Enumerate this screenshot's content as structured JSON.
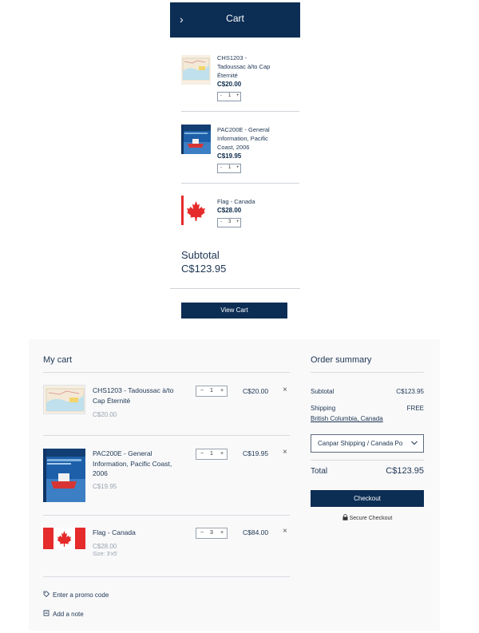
{
  "mini_cart": {
    "title": "Cart",
    "close_icon": "chevron-right-icon",
    "items": [
      {
        "name": "CHS1203 - Tadoussac à/to Cap Éternité",
        "name_lines": [
          "CHS1203 -",
          "Tadoussac à/to Cap",
          "Éternité"
        ],
        "price": "C$20.00",
        "quantity": "1",
        "thumbnail": "nautical-chart-image"
      },
      {
        "name": "PAC200E - General Information, Pacific Coast, 2006",
        "name_lines": [
          "PAC200E - General",
          "Information, Pacific",
          "Coast, 2006"
        ],
        "price": "C$19.95",
        "quantity": "1",
        "thumbnail": "book-cover-image"
      },
      {
        "name": "Flag - Canada",
        "name_lines": [
          "Flag - Canada"
        ],
        "price": "C$28.00",
        "quantity": "3",
        "thumbnail": "canada-flag-image"
      }
    ],
    "subtotal_label": "Subtotal",
    "subtotal_value": "C$123.95",
    "view_cart_label": "View Cart",
    "minus": "-",
    "plus": "+"
  },
  "full_cart": {
    "title": "My cart",
    "items": [
      {
        "name_lines": [
          "CHS1203 - Tadoussac à/to",
          "Cap Éternité"
        ],
        "unit_price": "C$20.00",
        "quantity": "1",
        "total": "C$20.00",
        "extra": ""
      },
      {
        "name_lines": [
          "PAC200E - General",
          "Information, Pacific Coast,",
          "2006"
        ],
        "unit_price": "C$19.95",
        "quantity": "1",
        "total": "C$19.95",
        "extra": ""
      },
      {
        "name_lines": [
          "Flag - Canada"
        ],
        "unit_price": "C$28.00",
        "quantity": "3",
        "total": "C$84.00",
        "extra": "Size: 3'x5'"
      }
    ],
    "remove_symbol": "×",
    "promo_label": "Enter a promo code",
    "note_label": "Add a note",
    "minus": "−",
    "plus": "+"
  },
  "order_summary": {
    "title": "Order summary",
    "subtotal_label": "Subtotal",
    "subtotal_value": "C$123.95",
    "shipping_label": "Shipping",
    "shipping_value": "FREE",
    "location": "British Columbia, Canada",
    "shipping_option": "Canpar Shipping / Canada Po",
    "total_label": "Total",
    "total_value": "C$123.95",
    "checkout_label": "Checkout",
    "secure_label": "Secure Checkout"
  },
  "colors": {
    "brand": "#0c2d54",
    "text": "#1d3552",
    "muted": "#9aa3ad",
    "flag_red": "#e52b2b"
  }
}
